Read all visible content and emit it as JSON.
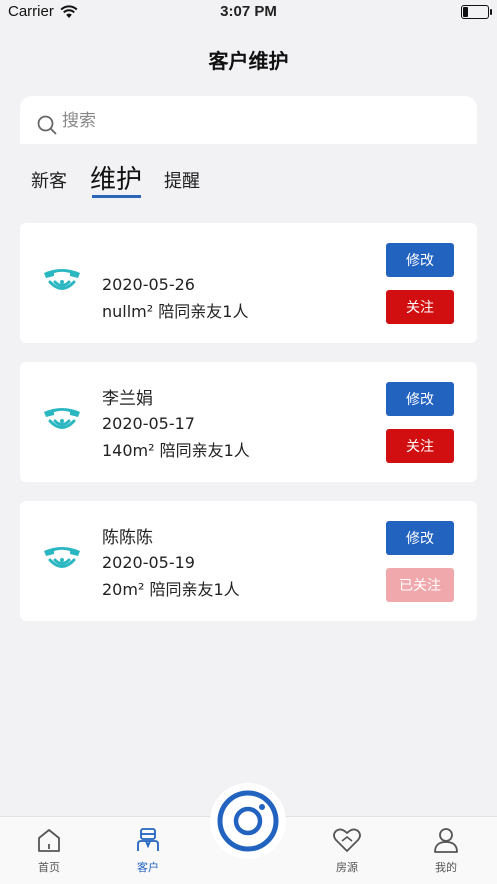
{
  "status": {
    "carrier": "Carrier",
    "time": "3:07 PM"
  },
  "title": "客户维护",
  "search": {
    "placeholder": "搜索"
  },
  "tabs": [
    {
      "label": "新客"
    },
    {
      "label": "维护",
      "active": true
    },
    {
      "label": "提醒"
    }
  ],
  "customers": [
    {
      "name": "",
      "date": "2020-05-26",
      "info": "nullm² 陪同亲友1人",
      "edit_label": "修改",
      "follow_label": "关注",
      "followed": false
    },
    {
      "name": "李兰娟",
      "date": "2020-05-17",
      "info": "140m² 陪同亲友1人",
      "edit_label": "修改",
      "follow_label": "关注",
      "followed": false
    },
    {
      "name": "陈陈陈",
      "date": "2020-05-19",
      "info": "20m² 陪同亲友1人",
      "edit_label": "修改",
      "follow_label": "已关注",
      "followed": true
    }
  ],
  "bottom_nav": [
    {
      "label": "首页",
      "icon": "home-icon",
      "active": false
    },
    {
      "label": "客户",
      "icon": "customer-icon",
      "active": true
    },
    {
      "label": "房源",
      "icon": "heart-house-icon",
      "active": false
    },
    {
      "label": "我的",
      "icon": "user-icon",
      "active": false
    }
  ],
  "camera": {
    "icon": "camera-icon"
  },
  "colors": {
    "primary": "#2263c0",
    "follow": "#d10e10",
    "followed": "#f1a8ac",
    "phone_icon": "#2bb7c2",
    "background": "#f2f1f3"
  }
}
